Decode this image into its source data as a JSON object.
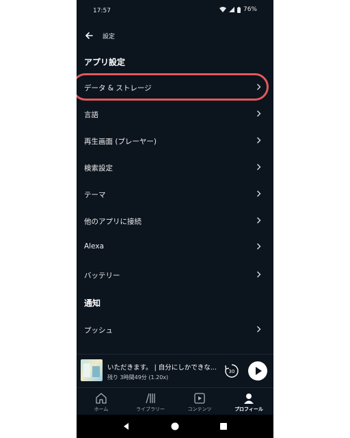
{
  "status_bar": {
    "time": "17:57",
    "battery": "76%"
  },
  "header": {
    "back_icon": "arrow-left-icon",
    "title": "設定"
  },
  "sections": [
    {
      "title": "アプリ設定"
    },
    {
      "title": "通知"
    }
  ],
  "app_settings": [
    {
      "label": "データ & ストレージ"
    },
    {
      "label": "言語"
    },
    {
      "label": "再生画面 (プレーヤー)"
    },
    {
      "label": "検索設定"
    },
    {
      "label": "テーマ"
    },
    {
      "label": "他のアプリに接続"
    },
    {
      "label": "Alexa"
    },
    {
      "label": "バッテリー"
    }
  ],
  "notifications": [
    {
      "label": "プッシュ"
    }
  ],
  "highlight_color": "#e25a5a",
  "mini_player": {
    "title": "いただきます。 | 自分にしかできな...",
    "subtitle": "残り 3時間49分 (1.20x)",
    "replay_seconds": "30"
  },
  "tabs": [
    {
      "label": "ホーム",
      "icon": "home-icon"
    },
    {
      "label": "ライブラリー",
      "icon": "library-icon"
    },
    {
      "label": "コンテンツ",
      "icon": "content-play-icon"
    },
    {
      "label": "プロフィール",
      "icon": "profile-icon",
      "active": true
    }
  ]
}
